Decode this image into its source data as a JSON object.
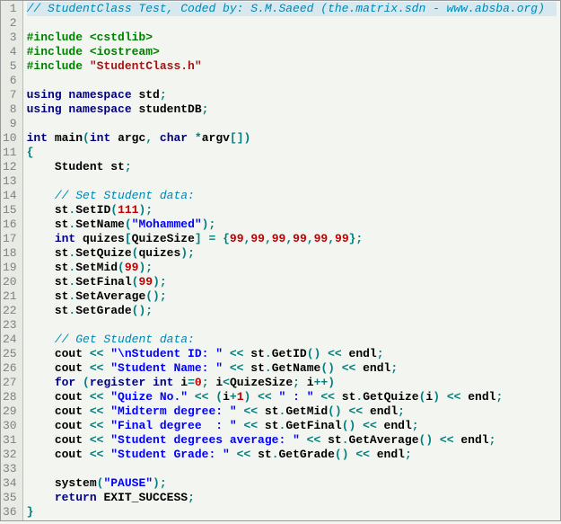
{
  "lines": [
    {
      "n": 1,
      "hl": true,
      "seg": [
        {
          "c": "comment",
          "t": "// StudentClass Test, Coded by: S.M.Saeed (the.matrix.sdn - www.absba.org)"
        }
      ]
    },
    {
      "n": 2,
      "seg": []
    },
    {
      "n": 3,
      "seg": [
        {
          "c": "pp",
          "t": "#include "
        },
        {
          "c": "pp-str",
          "t": "<cstdlib>"
        }
      ]
    },
    {
      "n": 4,
      "seg": [
        {
          "c": "pp",
          "t": "#include "
        },
        {
          "c": "pp-str",
          "t": "<iostream>"
        }
      ]
    },
    {
      "n": 5,
      "seg": [
        {
          "c": "pp",
          "t": "#include "
        },
        {
          "c": "pp-hdr",
          "t": "\"StudentClass.h\""
        }
      ]
    },
    {
      "n": 6,
      "seg": []
    },
    {
      "n": 7,
      "seg": [
        {
          "c": "kw",
          "t": "using namespace "
        },
        {
          "c": "ident",
          "t": "std"
        },
        {
          "c": "op",
          "t": ";"
        }
      ]
    },
    {
      "n": 8,
      "seg": [
        {
          "c": "kw",
          "t": "using namespace "
        },
        {
          "c": "ident",
          "t": "studentDB"
        },
        {
          "c": "op",
          "t": ";"
        }
      ]
    },
    {
      "n": 9,
      "seg": []
    },
    {
      "n": 10,
      "seg": [
        {
          "c": "kw",
          "t": "int "
        },
        {
          "c": "ident",
          "t": "main"
        },
        {
          "c": "op",
          "t": "("
        },
        {
          "c": "kw",
          "t": "int "
        },
        {
          "c": "ident",
          "t": "argc"
        },
        {
          "c": "op",
          "t": ", "
        },
        {
          "c": "kw",
          "t": "char "
        },
        {
          "c": "op",
          "t": "*"
        },
        {
          "c": "ident",
          "t": "argv"
        },
        {
          "c": "op",
          "t": "[])"
        }
      ]
    },
    {
      "n": 11,
      "seg": [
        {
          "c": "op",
          "t": "{"
        }
      ]
    },
    {
      "n": 12,
      "seg": [
        {
          "c": "ident",
          "t": "    Student st"
        },
        {
          "c": "op",
          "t": ";"
        }
      ]
    },
    {
      "n": 13,
      "seg": []
    },
    {
      "n": 14,
      "seg": [
        {
          "c": "ident",
          "t": "    "
        },
        {
          "c": "comment",
          "t": "// Set Student data:"
        }
      ]
    },
    {
      "n": 15,
      "seg": [
        {
          "c": "ident",
          "t": "    st"
        },
        {
          "c": "op",
          "t": "."
        },
        {
          "c": "ident",
          "t": "SetID"
        },
        {
          "c": "op",
          "t": "("
        },
        {
          "c": "num",
          "t": "111"
        },
        {
          "c": "op",
          "t": ");"
        }
      ]
    },
    {
      "n": 16,
      "seg": [
        {
          "c": "ident",
          "t": "    st"
        },
        {
          "c": "op",
          "t": "."
        },
        {
          "c": "ident",
          "t": "SetName"
        },
        {
          "c": "op",
          "t": "("
        },
        {
          "c": "str",
          "t": "\"Mohammed\""
        },
        {
          "c": "op",
          "t": ");"
        }
      ]
    },
    {
      "n": 17,
      "seg": [
        {
          "c": "ident",
          "t": "    "
        },
        {
          "c": "kw",
          "t": "int "
        },
        {
          "c": "ident",
          "t": "quizes"
        },
        {
          "c": "op",
          "t": "["
        },
        {
          "c": "ident",
          "t": "QuizeSize"
        },
        {
          "c": "op",
          "t": "] = {"
        },
        {
          "c": "num",
          "t": "99"
        },
        {
          "c": "op",
          "t": ","
        },
        {
          "c": "num",
          "t": "99"
        },
        {
          "c": "op",
          "t": ","
        },
        {
          "c": "num",
          "t": "99"
        },
        {
          "c": "op",
          "t": ","
        },
        {
          "c": "num",
          "t": "99"
        },
        {
          "c": "op",
          "t": ","
        },
        {
          "c": "num",
          "t": "99"
        },
        {
          "c": "op",
          "t": ","
        },
        {
          "c": "num",
          "t": "99"
        },
        {
          "c": "op",
          "t": "};"
        }
      ]
    },
    {
      "n": 18,
      "seg": [
        {
          "c": "ident",
          "t": "    st"
        },
        {
          "c": "op",
          "t": "."
        },
        {
          "c": "ident",
          "t": "SetQuize"
        },
        {
          "c": "op",
          "t": "("
        },
        {
          "c": "ident",
          "t": "quizes"
        },
        {
          "c": "op",
          "t": ");"
        }
      ]
    },
    {
      "n": 19,
      "seg": [
        {
          "c": "ident",
          "t": "    st"
        },
        {
          "c": "op",
          "t": "."
        },
        {
          "c": "ident",
          "t": "SetMid"
        },
        {
          "c": "op",
          "t": "("
        },
        {
          "c": "num",
          "t": "99"
        },
        {
          "c": "op",
          "t": ");"
        }
      ]
    },
    {
      "n": 20,
      "seg": [
        {
          "c": "ident",
          "t": "    st"
        },
        {
          "c": "op",
          "t": "."
        },
        {
          "c": "ident",
          "t": "SetFinal"
        },
        {
          "c": "op",
          "t": "("
        },
        {
          "c": "num",
          "t": "99"
        },
        {
          "c": "op",
          "t": ");"
        }
      ]
    },
    {
      "n": 21,
      "seg": [
        {
          "c": "ident",
          "t": "    st"
        },
        {
          "c": "op",
          "t": "."
        },
        {
          "c": "ident",
          "t": "SetAverage"
        },
        {
          "c": "op",
          "t": "();"
        }
      ]
    },
    {
      "n": 22,
      "seg": [
        {
          "c": "ident",
          "t": "    st"
        },
        {
          "c": "op",
          "t": "."
        },
        {
          "c": "ident",
          "t": "SetGrade"
        },
        {
          "c": "op",
          "t": "();"
        }
      ]
    },
    {
      "n": 23,
      "seg": []
    },
    {
      "n": 24,
      "seg": [
        {
          "c": "ident",
          "t": "    "
        },
        {
          "c": "comment",
          "t": "// Get Student data:"
        }
      ]
    },
    {
      "n": 25,
      "seg": [
        {
          "c": "ident",
          "t": "    cout "
        },
        {
          "c": "op",
          "t": "<< "
        },
        {
          "c": "str",
          "t": "\"\\nStudent ID: \""
        },
        {
          "c": "op",
          "t": " << "
        },
        {
          "c": "ident",
          "t": "st"
        },
        {
          "c": "op",
          "t": "."
        },
        {
          "c": "ident",
          "t": "GetID"
        },
        {
          "c": "op",
          "t": "() << "
        },
        {
          "c": "ident",
          "t": "endl"
        },
        {
          "c": "op",
          "t": ";"
        }
      ]
    },
    {
      "n": 26,
      "seg": [
        {
          "c": "ident",
          "t": "    cout "
        },
        {
          "c": "op",
          "t": "<< "
        },
        {
          "c": "str",
          "t": "\"Student Name: \""
        },
        {
          "c": "op",
          "t": " << "
        },
        {
          "c": "ident",
          "t": "st"
        },
        {
          "c": "op",
          "t": "."
        },
        {
          "c": "ident",
          "t": "GetName"
        },
        {
          "c": "op",
          "t": "() << "
        },
        {
          "c": "ident",
          "t": "endl"
        },
        {
          "c": "op",
          "t": ";"
        }
      ]
    },
    {
      "n": 27,
      "seg": [
        {
          "c": "ident",
          "t": "    "
        },
        {
          "c": "kw",
          "t": "for "
        },
        {
          "c": "op",
          "t": "("
        },
        {
          "c": "kw",
          "t": "register int "
        },
        {
          "c": "ident",
          "t": "i"
        },
        {
          "c": "op",
          "t": "="
        },
        {
          "c": "num",
          "t": "0"
        },
        {
          "c": "op",
          "t": "; "
        },
        {
          "c": "ident",
          "t": "i"
        },
        {
          "c": "op",
          "t": "<"
        },
        {
          "c": "ident",
          "t": "QuizeSize"
        },
        {
          "c": "op",
          "t": "; "
        },
        {
          "c": "ident",
          "t": "i"
        },
        {
          "c": "op",
          "t": "++)"
        }
      ]
    },
    {
      "n": 28,
      "seg": [
        {
          "c": "ident",
          "t": "    cout "
        },
        {
          "c": "op",
          "t": "<< "
        },
        {
          "c": "str",
          "t": "\"Quize No.\""
        },
        {
          "c": "op",
          "t": " << ("
        },
        {
          "c": "ident",
          "t": "i"
        },
        {
          "c": "op",
          "t": "+"
        },
        {
          "c": "num",
          "t": "1"
        },
        {
          "c": "op",
          "t": ") << "
        },
        {
          "c": "str",
          "t": "\" : \""
        },
        {
          "c": "op",
          "t": " << "
        },
        {
          "c": "ident",
          "t": "st"
        },
        {
          "c": "op",
          "t": "."
        },
        {
          "c": "ident",
          "t": "GetQuize"
        },
        {
          "c": "op",
          "t": "("
        },
        {
          "c": "ident",
          "t": "i"
        },
        {
          "c": "op",
          "t": ") << "
        },
        {
          "c": "ident",
          "t": "endl"
        },
        {
          "c": "op",
          "t": ";"
        }
      ]
    },
    {
      "n": 29,
      "seg": [
        {
          "c": "ident",
          "t": "    cout "
        },
        {
          "c": "op",
          "t": "<< "
        },
        {
          "c": "str",
          "t": "\"Midterm degree: \""
        },
        {
          "c": "op",
          "t": " << "
        },
        {
          "c": "ident",
          "t": "st"
        },
        {
          "c": "op",
          "t": "."
        },
        {
          "c": "ident",
          "t": "GetMid"
        },
        {
          "c": "op",
          "t": "() << "
        },
        {
          "c": "ident",
          "t": "endl"
        },
        {
          "c": "op",
          "t": ";"
        }
      ]
    },
    {
      "n": 30,
      "seg": [
        {
          "c": "ident",
          "t": "    cout "
        },
        {
          "c": "op",
          "t": "<< "
        },
        {
          "c": "str",
          "t": "\"Final degree  : \""
        },
        {
          "c": "op",
          "t": " << "
        },
        {
          "c": "ident",
          "t": "st"
        },
        {
          "c": "op",
          "t": "."
        },
        {
          "c": "ident",
          "t": "GetFinal"
        },
        {
          "c": "op",
          "t": "() << "
        },
        {
          "c": "ident",
          "t": "endl"
        },
        {
          "c": "op",
          "t": ";"
        }
      ]
    },
    {
      "n": 31,
      "seg": [
        {
          "c": "ident",
          "t": "    cout "
        },
        {
          "c": "op",
          "t": "<< "
        },
        {
          "c": "str",
          "t": "\"Student degrees average: \""
        },
        {
          "c": "op",
          "t": " << "
        },
        {
          "c": "ident",
          "t": "st"
        },
        {
          "c": "op",
          "t": "."
        },
        {
          "c": "ident",
          "t": "GetAverage"
        },
        {
          "c": "op",
          "t": "() << "
        },
        {
          "c": "ident",
          "t": "endl"
        },
        {
          "c": "op",
          "t": ";"
        }
      ]
    },
    {
      "n": 32,
      "seg": [
        {
          "c": "ident",
          "t": "    cout "
        },
        {
          "c": "op",
          "t": "<< "
        },
        {
          "c": "str",
          "t": "\"Student Grade: \""
        },
        {
          "c": "op",
          "t": " << "
        },
        {
          "c": "ident",
          "t": "st"
        },
        {
          "c": "op",
          "t": "."
        },
        {
          "c": "ident",
          "t": "GetGrade"
        },
        {
          "c": "op",
          "t": "() << "
        },
        {
          "c": "ident",
          "t": "endl"
        },
        {
          "c": "op",
          "t": ";"
        }
      ]
    },
    {
      "n": 33,
      "seg": []
    },
    {
      "n": 34,
      "seg": [
        {
          "c": "ident",
          "t": "    system"
        },
        {
          "c": "op",
          "t": "("
        },
        {
          "c": "str",
          "t": "\"PAUSE\""
        },
        {
          "c": "op",
          "t": ");"
        }
      ]
    },
    {
      "n": 35,
      "seg": [
        {
          "c": "ident",
          "t": "    "
        },
        {
          "c": "kw",
          "t": "return "
        },
        {
          "c": "ident",
          "t": "EXIT_SUCCESS"
        },
        {
          "c": "op",
          "t": ";"
        }
      ]
    },
    {
      "n": 36,
      "seg": [
        {
          "c": "op",
          "t": "}"
        }
      ]
    }
  ]
}
